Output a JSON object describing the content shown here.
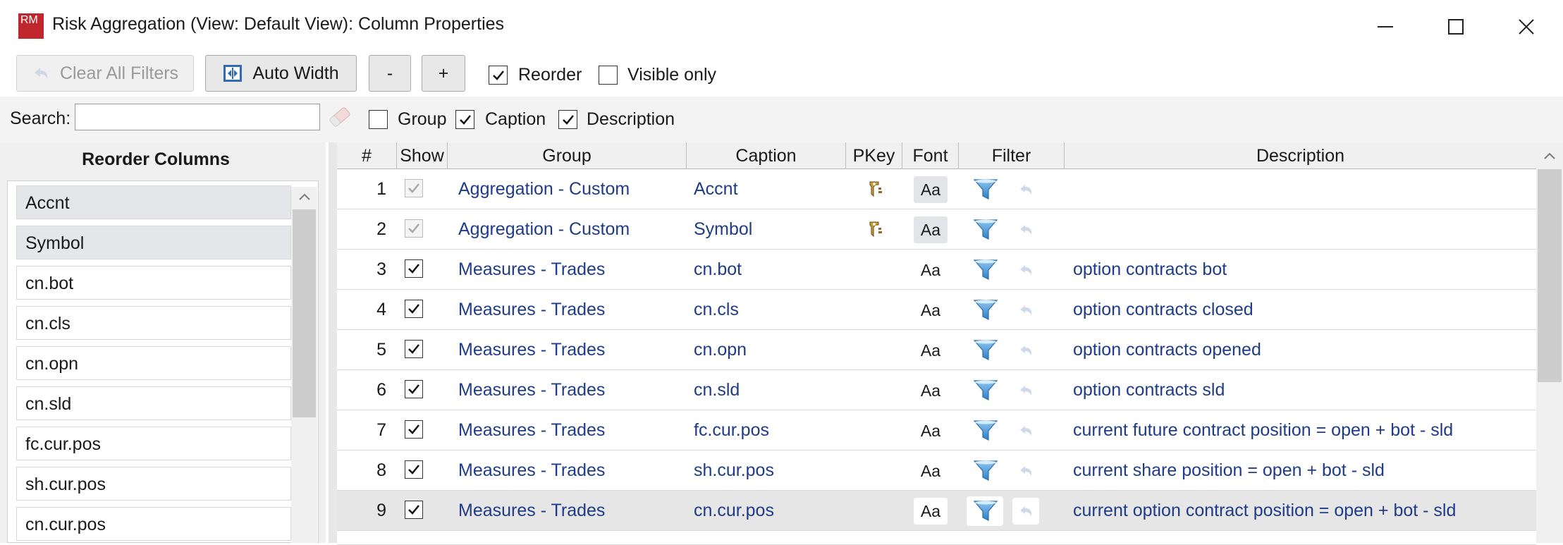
{
  "window": {
    "title": "Risk Aggregation (View: Default View): Column Properties",
    "app_icon_text": "RM",
    "icons": [
      "minimize-icon",
      "maximize-icon",
      "close-icon"
    ]
  },
  "toolbar": {
    "clear_filters_label": "Clear All Filters",
    "auto_width_label": "Auto Width",
    "minus_label": "-",
    "plus_label": "+",
    "reorder_label": "Reorder",
    "reorder_checked": true,
    "visible_only_label": "Visible only",
    "visible_only_checked": false
  },
  "search": {
    "label": "Search:",
    "value": "",
    "group_label": "Group",
    "group_checked": false,
    "caption_label": "Caption",
    "caption_checked": true,
    "description_label": "Description",
    "description_checked": true
  },
  "reorder_panel": {
    "title": "Reorder Columns",
    "items": [
      {
        "label": "Accnt",
        "selected": true
      },
      {
        "label": "Symbol",
        "selected": true
      },
      {
        "label": "cn.bot",
        "selected": false
      },
      {
        "label": "cn.cls",
        "selected": false
      },
      {
        "label": "cn.opn",
        "selected": false
      },
      {
        "label": "cn.sld",
        "selected": false
      },
      {
        "label": "fc.cur.pos",
        "selected": false
      },
      {
        "label": "sh.cur.pos",
        "selected": false
      },
      {
        "label": "cn.cur.pos",
        "selected": false
      }
    ]
  },
  "grid": {
    "columns": [
      "#",
      "Show",
      "Group",
      "Caption",
      "PKey",
      "Font",
      "Filter",
      "Description"
    ],
    "rows": [
      {
        "num": "1",
        "show": true,
        "show_enabled": false,
        "group": "Aggregation - Custom",
        "caption": "Accnt",
        "pkey": true,
        "font": "Aa",
        "description": ""
      },
      {
        "num": "2",
        "show": true,
        "show_enabled": false,
        "group": "Aggregation - Custom",
        "caption": "Symbol",
        "pkey": true,
        "font": "Aa",
        "description": ""
      },
      {
        "num": "3",
        "show": true,
        "show_enabled": true,
        "group": "Measures - Trades",
        "caption": "cn.bot",
        "pkey": false,
        "font": "Aa",
        "description": "option contracts bot"
      },
      {
        "num": "4",
        "show": true,
        "show_enabled": true,
        "group": "Measures - Trades",
        "caption": "cn.cls",
        "pkey": false,
        "font": "Aa",
        "description": "option contracts closed"
      },
      {
        "num": "5",
        "show": true,
        "show_enabled": true,
        "group": "Measures - Trades",
        "caption": "cn.opn",
        "pkey": false,
        "font": "Aa",
        "description": "option contracts opened"
      },
      {
        "num": "6",
        "show": true,
        "show_enabled": true,
        "group": "Measures - Trades",
        "caption": "cn.sld",
        "pkey": false,
        "font": "Aa",
        "description": "option contracts sld"
      },
      {
        "num": "7",
        "show": true,
        "show_enabled": true,
        "group": "Measures - Trades",
        "caption": "fc.cur.pos",
        "pkey": false,
        "font": "Aa",
        "description": "current future contract position = open + bot - sld"
      },
      {
        "num": "8",
        "show": true,
        "show_enabled": true,
        "group": "Measures - Trades",
        "caption": "sh.cur.pos",
        "pkey": false,
        "font": "Aa",
        "description": "current share position = open + bot - sld"
      },
      {
        "num": "9",
        "show": true,
        "show_enabled": true,
        "group": "Measures - Trades",
        "caption": "cn.cur.pos",
        "pkey": false,
        "font": "Aa",
        "description": "current option contract position = open + bot - sld",
        "selected": true
      }
    ]
  },
  "colors": {
    "accent_text": "#1f3c88",
    "app_icon_bg": "#c0262d",
    "filter_icon": "#3a8fd6"
  }
}
